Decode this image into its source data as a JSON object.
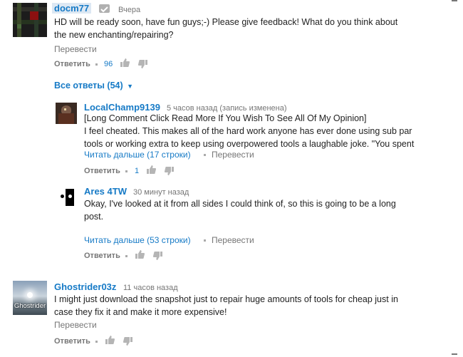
{
  "comments": {
    "c1": {
      "author": "docm77",
      "time": "Вчера",
      "text_lines": [
        "HD will be ready soon, have fun guys;-) Please give feedback! What do you think about",
        "the new enchanting/repairing?"
      ],
      "translate": "Перевести",
      "reply": "Ответить",
      "likes": "96",
      "all_replies": "Все ответы (54)"
    },
    "r1": {
      "author": "LocalChamp9139",
      "time": "5 часов назад (запись изменена)",
      "text_lines": [
        "[Long Comment Click Read More If You Wish To See All Of My Opinion]",
        "I feel cheated. This makes all of the hard work anyone has ever done using sub par",
        "tools or working extra to keep using overpowered tools a laughable joke. \"You spent"
      ],
      "read_more": "Читать дальше (17 строки)",
      "translate": "Перевести",
      "reply": "Ответить",
      "likes": "1"
    },
    "r2": {
      "author": "Ares 4TW",
      "time": "30 минут назад",
      "text_lines": [
        "Okay, I've looked at it from all sides I could think of, so this is going to be a long",
        "post."
      ],
      "read_more": "Читать дальше (53 строки)",
      "translate": "Перевести",
      "reply": "Ответить"
    },
    "c2": {
      "author": "Ghostrider03z",
      "time": "11 часов назад",
      "avatar_text": "Ghostrider",
      "text_lines": [
        "I might just download the snapshot just to repair huge amounts of tools for cheap just in",
        "case they fix it and make it more expensive!"
      ],
      "translate": "Перевести",
      "reply": "Ответить"
    }
  },
  "colors": {
    "link": "#167ac6",
    "muted": "#767676",
    "highlight": "#dde8f3"
  },
  "icons": [
    "check-icon",
    "thumb-up-icon",
    "thumb-down-icon"
  ]
}
